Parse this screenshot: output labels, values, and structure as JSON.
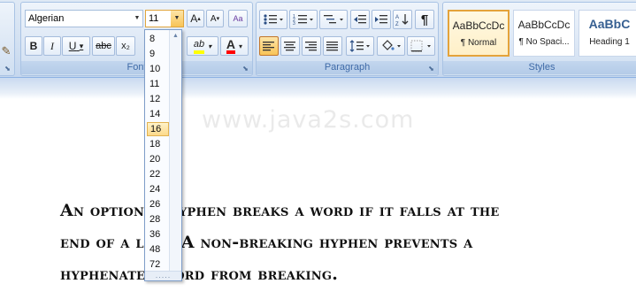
{
  "font": {
    "font_name": "Algerian",
    "font_size": "11",
    "group_label": "Font",
    "bold": "B",
    "italic": "I",
    "underline": "U",
    "strikethrough": "abc",
    "subscript": "x₂",
    "grow": "A",
    "shrink": "A",
    "clear_format": "Aa",
    "highlight": "ab",
    "font_color": "A",
    "underline_arrow": "▾"
  },
  "paragraph": {
    "group_label": "Paragraph",
    "show_marks": "¶"
  },
  "styles": {
    "group_label": "Styles",
    "items": [
      {
        "sample": "AaBbCcDc",
        "name": "¶ Normal"
      },
      {
        "sample": "AaBbCcDc",
        "name": "¶ No Spaci..."
      },
      {
        "sample": "AaBbC",
        "name": "Heading 1"
      }
    ]
  },
  "clipboard": {
    "brush": "✎"
  },
  "font_size_dropdown": {
    "items": [
      "8",
      "9",
      "10",
      "11",
      "12",
      "14",
      "16",
      "18",
      "20",
      "22",
      "24",
      "26",
      "28",
      "36",
      "48",
      "72"
    ],
    "selected": "16",
    "grip": "....."
  },
  "document": {
    "watermark": "www.java2s.com",
    "lines": [
      "An optional hyphen breaks a word if it falls at the",
      "end of a line. A non-breaking hyphen prevents a",
      "hyphenated word from breaking."
    ]
  },
  "colors": {
    "ribbon": "#d3e1f2",
    "group_label": "#3e6aa7",
    "highlight_bar": "#ffff00",
    "font_color_bar": "#ff0000",
    "selected_item": "#fcd98a"
  }
}
